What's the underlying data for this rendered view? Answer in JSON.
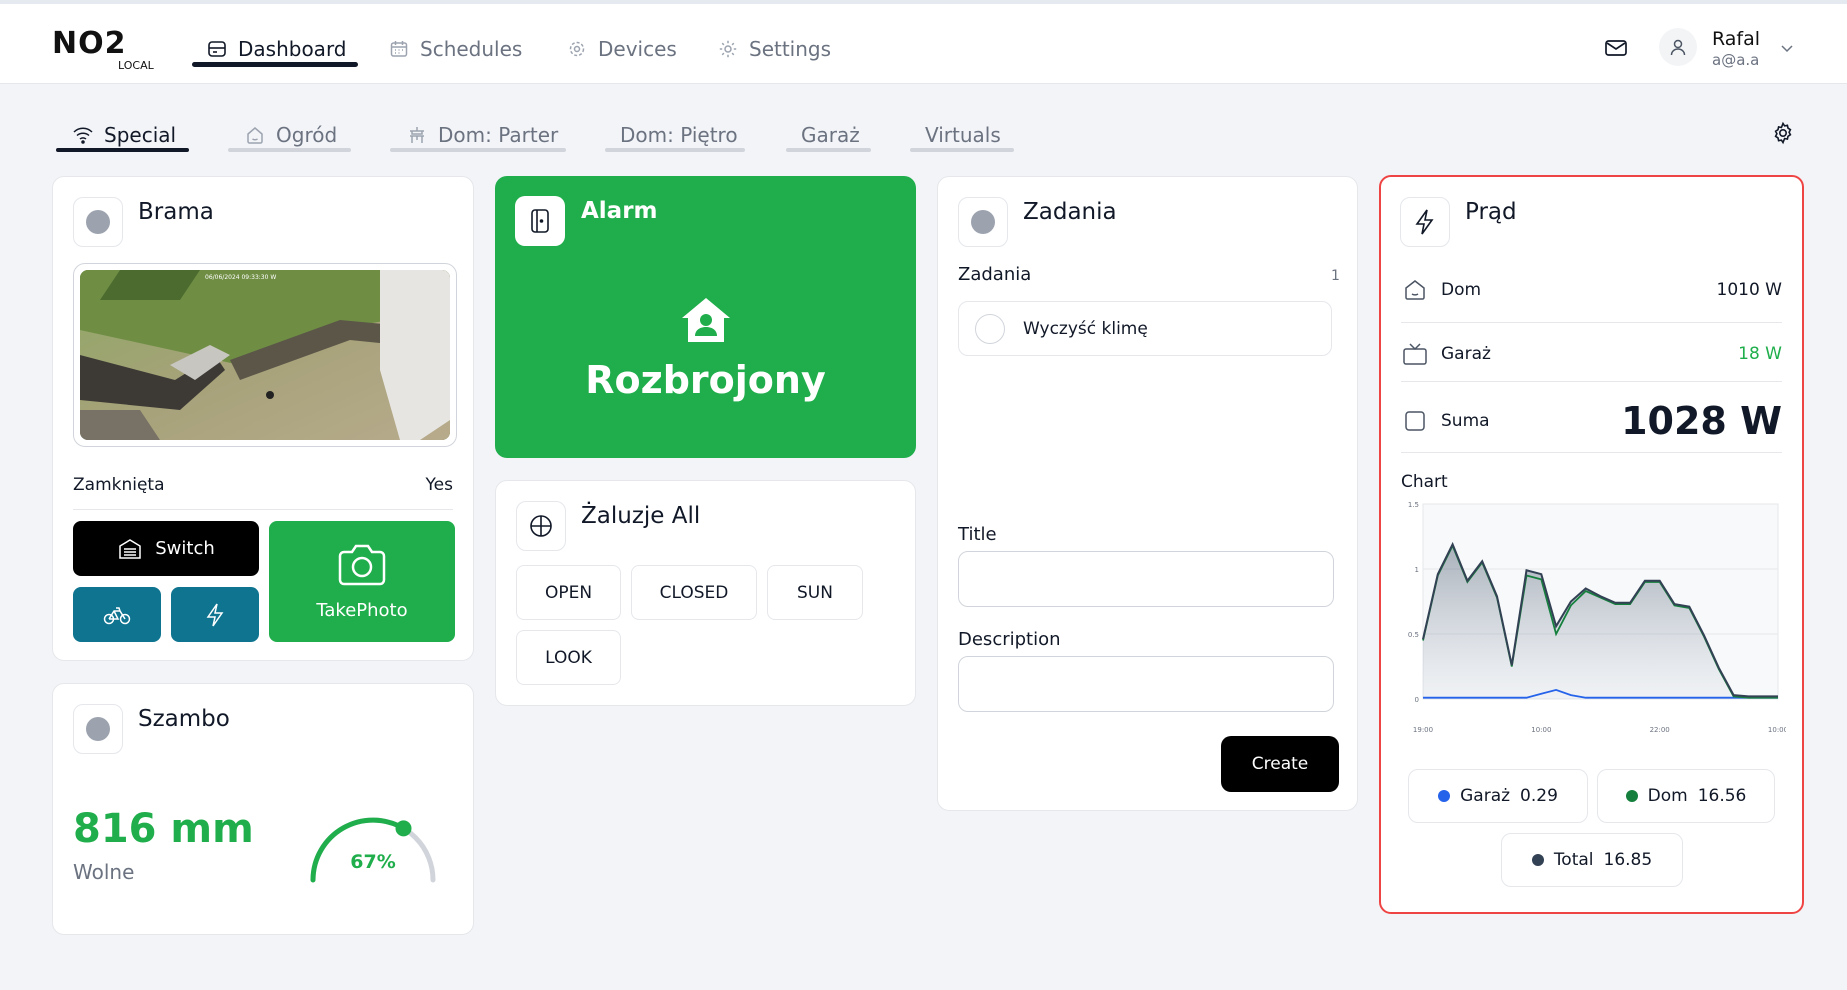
{
  "app": {
    "logo_text": "NO2",
    "logo_sub": "LOCAL"
  },
  "nav": {
    "items": [
      {
        "label": "Dashboard",
        "icon": "dashboard-icon"
      },
      {
        "label": "Schedules",
        "icon": "calendar-icon"
      },
      {
        "label": "Devices",
        "icon": "chip-icon"
      },
      {
        "label": "Settings",
        "icon": "gear-icon"
      }
    ],
    "active": "Dashboard"
  },
  "user": {
    "name": "Rafal",
    "email": "a@a.a"
  },
  "tabs": {
    "items": [
      {
        "label": "Special",
        "icon": "wifi-icon"
      },
      {
        "label": "Ogród",
        "icon": "house-icon"
      },
      {
        "label": "Dom: Parter",
        "icon": "table-icon"
      },
      {
        "label": "Dom: Piętro",
        "icon": ""
      },
      {
        "label": "Garaż",
        "icon": ""
      },
      {
        "label": "Virtuals",
        "icon": ""
      }
    ],
    "active": "Special"
  },
  "brama": {
    "title": "Brama",
    "camera_timestamp": "06/06/2024 09:33:30 W",
    "status_label": "Zamknięta",
    "status_value": "Yes",
    "switch_label": "Switch",
    "photo_label": "TakePhoto"
  },
  "szambo": {
    "title": "Szambo",
    "value": "816 mm",
    "subtitle": "Wolne",
    "percent_text": "67%",
    "percent": 0.67
  },
  "alarm": {
    "title": "Alarm",
    "state": "Rozbrojony"
  },
  "zaluzje": {
    "title": "Żaluzje All",
    "buttons": [
      "OPEN",
      "CLOSED",
      "SUN",
      "LOOK"
    ]
  },
  "zadania": {
    "title": "Zadania",
    "list_label": "Zadania",
    "count": "1",
    "tasks": [
      "Wyczyść klimę"
    ],
    "title_label": "Title",
    "title_value": "",
    "description_label": "Description",
    "description_value": "",
    "create_label": "Create"
  },
  "prad": {
    "title": "Prąd",
    "rows": [
      {
        "label": "Dom",
        "value": "1010 W"
      },
      {
        "label": "Garaż",
        "value": "18 W"
      },
      {
        "label": "Suma",
        "value": "1028 W"
      }
    ],
    "chart_label": "Chart",
    "legend": [
      {
        "name": "Garaż",
        "value": "0.29",
        "color": "#2563eb"
      },
      {
        "name": "Dom",
        "value": "16.56",
        "color": "#15803d"
      },
      {
        "name": "Total",
        "value": "16.85",
        "color": "#334155"
      }
    ]
  },
  "colors": {
    "accent_green": "#1fae4b",
    "teal": "#0e7490",
    "alert_border": "#ef4444"
  },
  "chart_data": {
    "type": "area",
    "x_tick_labels": [
      "19:00",
      "10:00",
      "22:00",
      "10:00"
    ],
    "y_tick_labels": [
      "1.5",
      "1",
      "0.5",
      "0"
    ],
    "ylim": [
      0,
      1.5
    ],
    "x": [
      0,
      1,
      2,
      3,
      4,
      5,
      6,
      7,
      8,
      9,
      10,
      11,
      12,
      13,
      14,
      15,
      16,
      17,
      18,
      19,
      20,
      21,
      22,
      23,
      24
    ],
    "series": [
      {
        "name": "Garaż",
        "color": "#2563eb",
        "values": [
          0.01,
          0.01,
          0.01,
          0.01,
          0.01,
          0.01,
          0.01,
          0.01,
          0.04,
          0.07,
          0.03,
          0.01,
          0.01,
          0.01,
          0.01,
          0.01,
          0.01,
          0.01,
          0.01,
          0.01,
          0.01,
          0.01,
          0.01,
          0.01,
          0.01
        ]
      },
      {
        "name": "Dom",
        "color": "#15803d",
        "values": [
          0.45,
          0.95,
          1.18,
          0.9,
          1.05,
          0.78,
          0.25,
          0.95,
          0.92,
          0.5,
          0.72,
          0.83,
          0.78,
          0.73,
          0.73,
          0.9,
          0.9,
          0.72,
          0.7,
          0.48,
          0.23,
          0.02,
          0.01,
          0.01,
          0.01
        ]
      },
      {
        "name": "Total",
        "color": "#334155",
        "values": [
          0.46,
          0.96,
          1.19,
          0.91,
          1.06,
          0.79,
          0.26,
          0.99,
          0.96,
          0.56,
          0.75,
          0.85,
          0.79,
          0.74,
          0.74,
          0.91,
          0.91,
          0.73,
          0.71,
          0.49,
          0.24,
          0.03,
          0.02,
          0.02,
          0.02
        ]
      }
    ]
  }
}
